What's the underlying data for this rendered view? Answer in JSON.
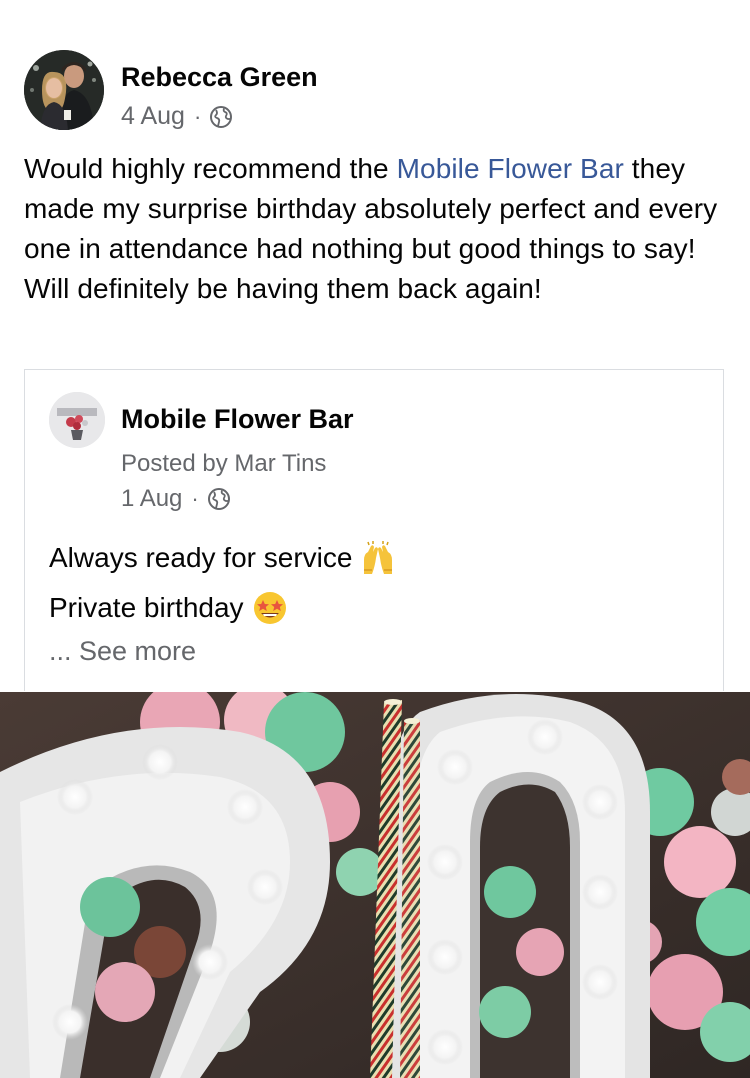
{
  "post": {
    "author_name": "Rebecca Green",
    "date": "4 Aug",
    "separator": "·",
    "privacy_icon": "globe-icon",
    "text_before_mention": "Would highly recommend the ",
    "mention": "Mobile Flower Bar",
    "text_after_mention": " they made my surprise birthday absolutely perfect and every one in attendance had nothing but good things to say! Will definitely be having them back again!"
  },
  "shared_post": {
    "page_name": "Mobile Flower Bar",
    "posted_by": "Posted by Mar Tins",
    "date": "1 Aug",
    "separator": "·",
    "privacy_icon": "globe-icon",
    "line1": "Always ready for service",
    "line1_emoji": "raising-hands-emoji",
    "line2": "Private birthday",
    "line2_emoji": "star-struck-emoji",
    "see_more": "... See more"
  },
  "colors": {
    "mention": "#385898",
    "secondary_text": "#65676b",
    "border": "#dadde1"
  }
}
